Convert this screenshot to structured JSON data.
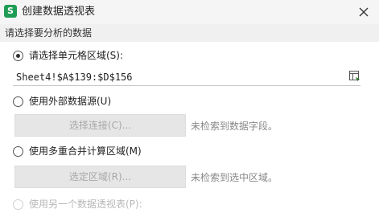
{
  "window": {
    "title": "创建数据透视表",
    "logo_letter": "S",
    "close_icon": "close-icon"
  },
  "section": {
    "header": "请选择要分析的数据"
  },
  "options": {
    "select_range": {
      "label": "请选择单元格区域(S):",
      "checked": true,
      "value": "Sheet4!$A$139:$D$156",
      "picker_icon": "range-picker-icon"
    },
    "external_source": {
      "label": "使用外部数据源(U)",
      "checked": false,
      "button_label": "选择连接(C)...",
      "hint": "未检索到数据字段。"
    },
    "multi_consolidation": {
      "label": "使用多重合并计算区域(M)",
      "checked": false,
      "button_label": "选定区域(R)...",
      "hint": "未检索到选中区域。"
    },
    "another_pivot": {
      "label": "使用另一个数据透视表(P):",
      "checked": false,
      "disabled": true
    }
  },
  "colors": {
    "header_bg": "#f0f0f0",
    "button_bg": "#e6e6e6",
    "disabled_text": "#b8b8b8",
    "hint_text": "#888888",
    "logo_green": "#1f9d55"
  }
}
